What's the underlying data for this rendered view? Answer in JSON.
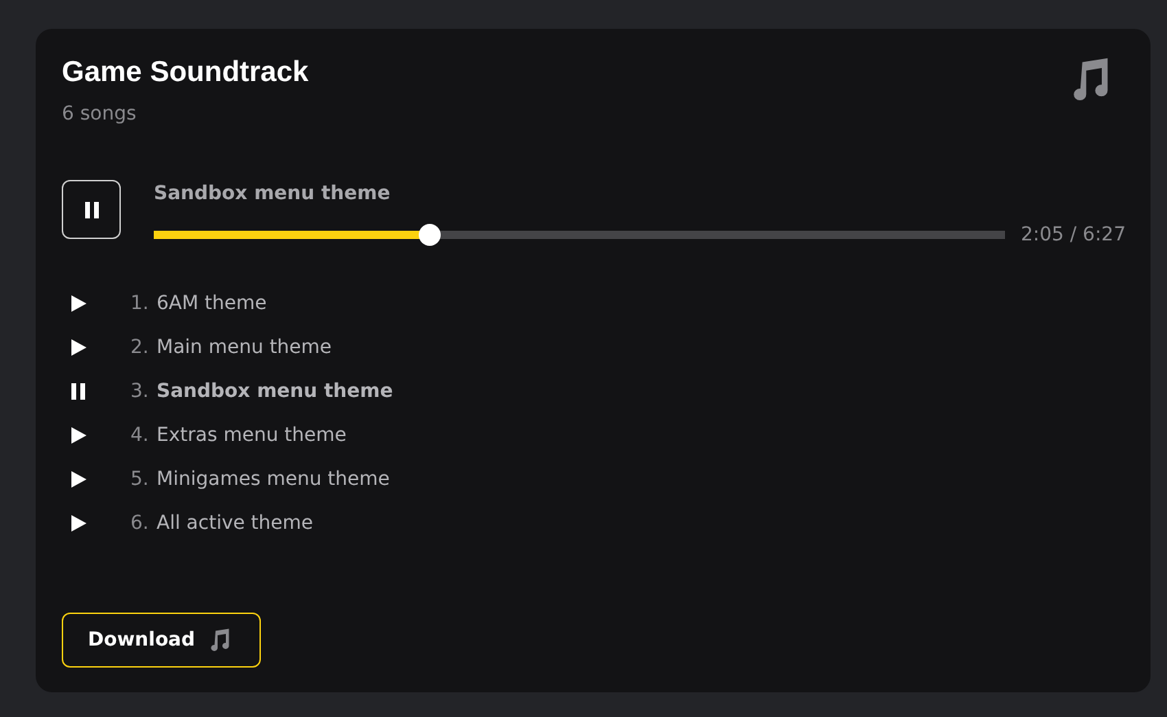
{
  "album": {
    "title": "Game Soundtrack",
    "subtitle": "6 songs"
  },
  "player": {
    "playing": true,
    "now_playing": "Sandbox menu theme",
    "level": 0.324,
    "time": "2:05 / 6:27"
  },
  "tracks": [
    {
      "number": "1.",
      "title": "6AM theme",
      "selected": false
    },
    {
      "number": "2.",
      "title": "Main menu theme",
      "selected": false
    },
    {
      "number": "3.",
      "title": "Sandbox menu theme",
      "selected": true
    },
    {
      "number": "4.",
      "title": "Extras menu theme",
      "selected": false
    },
    {
      "number": "5.",
      "title": "Minigames menu theme",
      "selected": false
    },
    {
      "number": "6.",
      "title": "All active theme",
      "selected": false
    }
  ],
  "download_button": {
    "label": "Download"
  }
}
